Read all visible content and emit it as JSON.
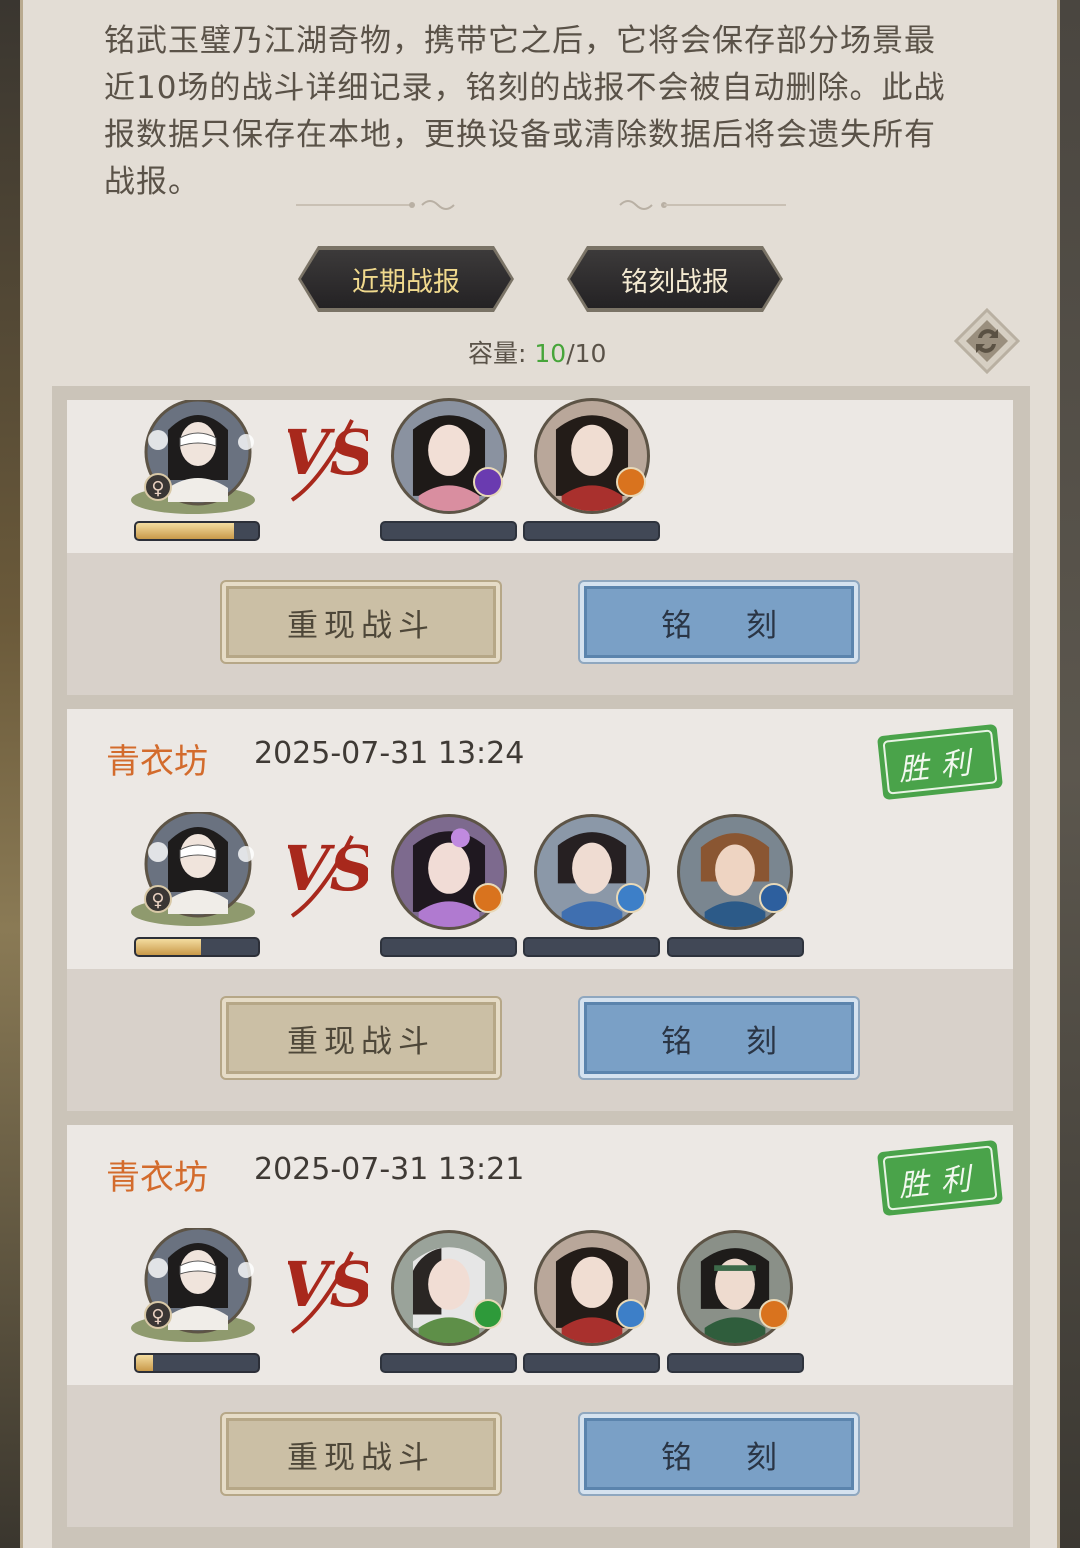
{
  "description": "铭武玉璧乃江湖奇物，携带它之后，它将会保存部分场景最近10场的战斗详细记录，铭刻的战报不会被自动删除。此战报数据只保存在本地，更换设备或清除数据后将会遗失所有战报。",
  "tabs": [
    {
      "label": "近期战报",
      "active": true
    },
    {
      "label": "铭刻战报",
      "active": false
    }
  ],
  "capacity": {
    "label": "容量:",
    "current": "10",
    "separator": "/",
    "max": "10"
  },
  "vs_text": "VS",
  "records": [
    {
      "location": "",
      "time": "",
      "result": "",
      "player_hp": 0.8,
      "opponents": [
        "girl-pink-icon",
        "girl-red-icon"
      ],
      "replay_label": "重现战斗",
      "engrave_label": "铭 刻"
    },
    {
      "location": "青衣坊",
      "time": "2025-07-31 13:24",
      "result": "胜利",
      "player_hp": 0.53,
      "opponents": [
        "girl-purple-icon",
        "youth-blue-icon",
        "warrior-brown-icon"
      ],
      "replay_label": "重现战斗",
      "engrave_label": "铭 刻"
    },
    {
      "location": "青衣坊",
      "time": "2025-07-31 13:21",
      "result": "胜利",
      "player_hp": 0.14,
      "opponents": [
        "girl-green-icon",
        "girl-red-icon",
        "swordsman-green-icon"
      ],
      "replay_label": "重现战斗",
      "engrave_label": "铭 刻"
    }
  ],
  "colors": {
    "location": "#d36b2c",
    "capacity_current": "#47a53a",
    "win_stamp": "#4aa34a",
    "engrave_button": "#7aa0c6",
    "replay_button": "#cbbfa5"
  }
}
